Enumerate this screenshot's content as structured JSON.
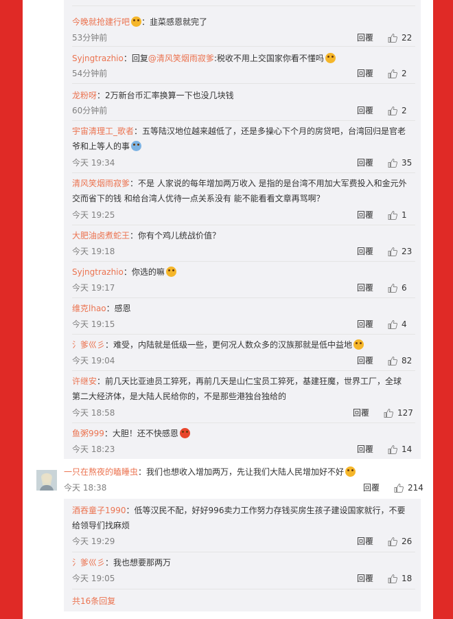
{
  "reply_label": "回覆",
  "colors": {
    "username": "#eb7350",
    "background_red": "#e02a26",
    "reply_bg": "#f2f2f5"
  },
  "replies_a": [
    {
      "user": "今晚就抢建行吧",
      "emoji": "emoji-laugh",
      "text": "：韭菜感恩就完了",
      "time": "53分钟前",
      "likes": "22"
    },
    {
      "user": "Syjngtrazhio",
      "prefix": "：回复",
      "mention": "@清风笑烟雨寂爹",
      "text": ":税收不用上交国家你看不懂吗",
      "emoji": "emoji-grin",
      "time": "54分钟前",
      "likes": "2"
    },
    {
      "user": "龙粉呀",
      "text": "：2万新台币汇率换算一下也没几块钱",
      "time": "60分钟前",
      "likes": "2"
    },
    {
      "user": "宇宙清理工_歌者",
      "text": "：五等陆汉地位越来越低了，还是多操心下个月的房贷吧，台湾回归是官老爷和上等人的事",
      "emoji": "emoji-surprise",
      "time": "今天 19:34",
      "likes": "35"
    },
    {
      "user": "清风笑烟雨寂爹",
      "text": "：不是 人家说的每年增加两万收入 是指的是台湾不用加大军费投入和金元外交而省下的钱 和给台湾人优待一点关系没有 能不能看看文章再骂啊？",
      "time": "今天 19:25",
      "likes": "1"
    },
    {
      "user": "大肥油卤煮蛇王",
      "text": "：你有个鸡儿统战价值？",
      "time": "今天 19:18",
      "likes": "23"
    },
    {
      "user": "Syjngtrazhio",
      "text": "：你选的嘛",
      "emoji": "emoji-grin",
      "time": "今天 19:17",
      "likes": "6"
    },
    {
      "user": "维克lhao",
      "text": "：感恩",
      "time": "今天 19:15",
      "likes": "4"
    },
    {
      "user": "氵爹巛彡",
      "text": "：难受，内陆就是低级一些，更何况人数众多的汉族那就是低中益地",
      "emoji": "emoji-cry",
      "time": "今天 19:04",
      "likes": "82"
    },
    {
      "user": "许继安",
      "text": "：前几天比亚迪员工猝死，再前几天是山仁宝员工猝死，基建狂魔，世界工厂，全球第二大经济体，是大陆人民给你的，不是那些港独台独给的",
      "time": "今天 18:58",
      "likes": "127"
    },
    {
      "user": "鱼粥999",
      "text": "：大胆！还不快感恩",
      "emoji": "emoji-angry",
      "time": "今天 18:23",
      "likes": "14"
    }
  ],
  "top_comment": {
    "user": "一只在熬夜的瞌睡虫",
    "text": "：我们也想收入增加两万，先让我们大陆人民增加好不好",
    "emoji": "emoji-sweat",
    "time": "今天 18:38",
    "likes": "214"
  },
  "replies_b": [
    {
      "user": "酒吞童子1990",
      "text": "：低等汉民不配，好好996卖力工作努力存钱买房生孩子建设国家就行，不要给领导们找麻烦",
      "time": "今天 19:29",
      "likes": "26"
    },
    {
      "user": "氵爹巛彡",
      "text": "：我也想要那两万",
      "time": "今天 19:05",
      "likes": "18"
    }
  ],
  "total_replies": "共16条回复"
}
